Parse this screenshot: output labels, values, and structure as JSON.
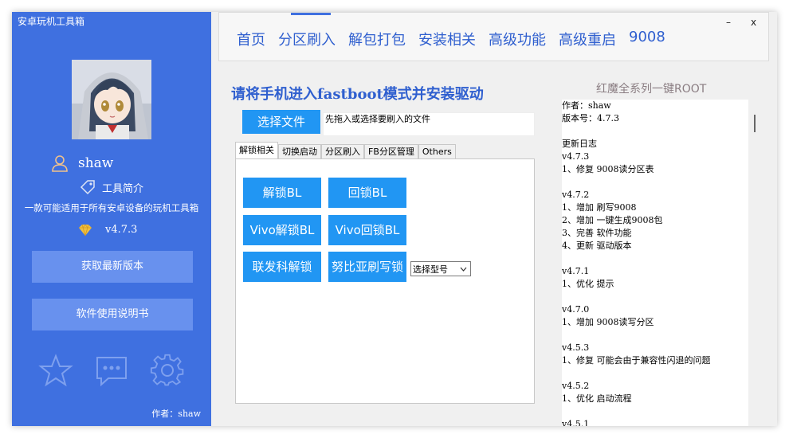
{
  "app": {
    "title": "安卓玩机工具箱"
  },
  "sidebar": {
    "username": "shaw",
    "intro_label": "工具简介",
    "tagline": "一款可能适用于所有安卓设备的玩机工具箱",
    "version": "v4.7.3",
    "buttons": {
      "latest": "获取最新版本",
      "manual": "软件使用说明书"
    },
    "author": "作者：shaw"
  },
  "nav": {
    "items": [
      "首页",
      "分区刷入",
      "解包打包",
      "安装相关",
      "高级功能",
      "高级重启",
      "9008"
    ],
    "minimize": "–",
    "close": "x"
  },
  "main": {
    "title": "请将手机进入fastboot模式并安装驱动",
    "select_file_button": "选择文件",
    "file_path_placeholder": "先拖入或选择要刷入的文件",
    "tabs": [
      "解锁相关",
      "切换启动",
      "分区刷入",
      "FB分区管理",
      "Others"
    ],
    "active_tab": "解锁相关",
    "buttons": {
      "unlock_bl": "解锁BL",
      "relock_bl": "回锁BL",
      "vivo_unlock": "Vivo解锁BL",
      "vivo_relock": "Vivo回锁BL",
      "mtk_unlock": "联发科解锁",
      "nubia_write_lock": "努比亚刷写锁"
    },
    "model_select": {
      "selected": "选择型号"
    }
  },
  "changelog": {
    "title": "红魔全系列一键ROOT",
    "lines": [
      "作者：shaw",
      "版本号：4.7.3",
      "",
      "更新日志",
      "v4.7.3",
      "1、修复 9008读分区表",
      "",
      "v4.7.2",
      "1、增加 刷写9008",
      "2、增加 一键生成9008包",
      "3、完善 软件功能",
      "4、更新 驱动版本",
      "",
      "v4.7.1",
      "1、优化 提示",
      "",
      "v4.7.0",
      "1、增加 9008读写分区",
      "",
      "v4.5.3",
      "1、修复 可能会由于兼容性闪退的问题",
      "",
      "v4.5.2",
      "1、优化 启动流程",
      "",
      "v4.5.1"
    ]
  },
  "colors": {
    "sidebar": "#3f70e0",
    "sidebar_button": "#6891ee",
    "accent_button": "#2196f3",
    "nav_text": "#2f5fcf",
    "log_title": "#8a7d82"
  }
}
